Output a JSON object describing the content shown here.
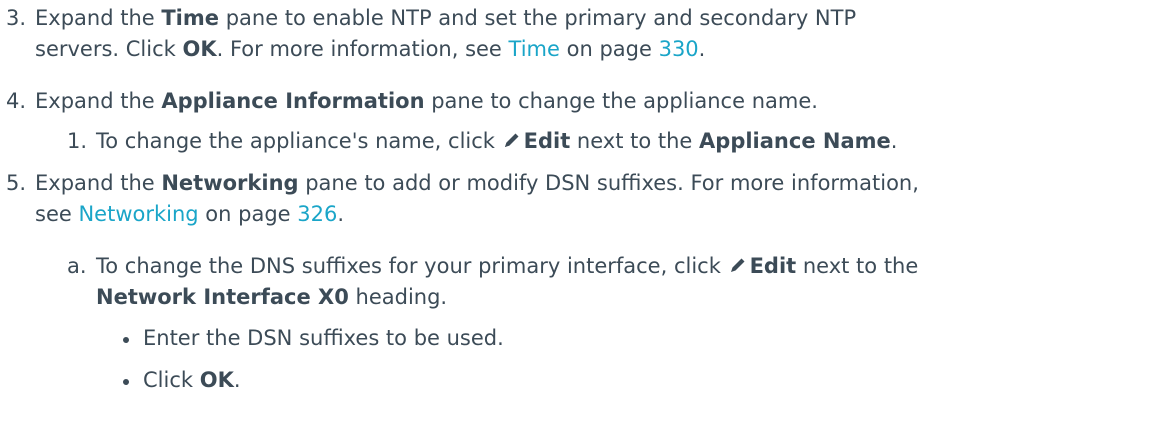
{
  "steps": [
    {
      "marker": "3.",
      "line1": {
        "t1": "Expand the ",
        "b1": "Time",
        "t2": " pane to enable NTP and set the primary and secondary NTP"
      },
      "line2": {
        "t1": "servers. Click ",
        "b1": "OK",
        "t2": ". For more information, see ",
        "link1": "Time",
        "t3": " on page ",
        "link2": "330",
        "t4": "."
      }
    },
    {
      "marker": "4.",
      "line1": {
        "t1": "Expand the ",
        "b1": "Appliance Information",
        "t2": " pane to change the appliance name."
      },
      "sub": {
        "marker": "1.",
        "t1": "To change the appliance's name, click ",
        "b1": "Edit",
        "t2": " next to the ",
        "b2": "Appliance Name",
        "t3": "."
      }
    },
    {
      "marker": "5.",
      "line1": {
        "t1": "Expand the ",
        "b1": "Networking",
        "t2": " pane to add or modify DSN suffixes. For more information,"
      },
      "line2": {
        "t1": "see ",
        "link1": "Networking",
        "t2": " on page ",
        "link2": "326",
        "t3": "."
      },
      "sub": {
        "marker": "a.",
        "line1": {
          "t1": "To change the DNS suffixes for your primary interface, click ",
          "b1": "Edit",
          "t2": " next to the"
        },
        "line2": {
          "b1": "Network Interface X0",
          "t1": " heading."
        },
        "bullets": [
          {
            "t1": "Enter the DSN suffixes to be used."
          },
          {
            "t1": "Click ",
            "b1": "OK",
            "t2": "."
          }
        ]
      }
    }
  ],
  "icons": {
    "edit": "pencil-icon"
  },
  "colors": {
    "text": "#3c4b57",
    "link": "#1aa5c8"
  }
}
